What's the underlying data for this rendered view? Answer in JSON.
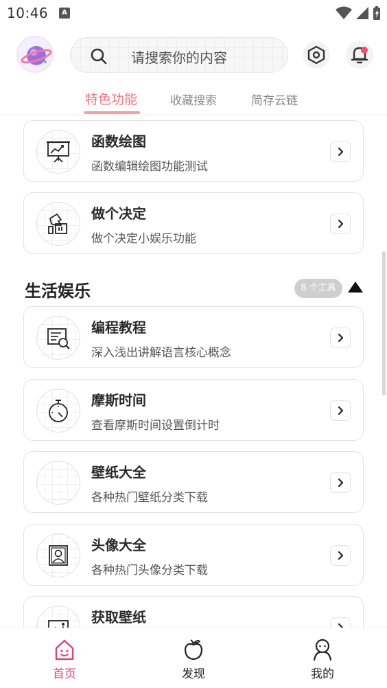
{
  "status_bar": {
    "time": "10:46",
    "notification_icon": "A"
  },
  "header": {
    "logo_icon": "planet-logo-icon",
    "search_placeholder": "请搜索你的内容",
    "settings_icon": "hexagon-settings-icon",
    "bell_icon": "bell-icon"
  },
  "tabs": [
    {
      "label": "特色功能",
      "active": true
    },
    {
      "label": "收藏搜索",
      "active": false
    },
    {
      "label": "简存云链",
      "active": false
    }
  ],
  "cards_top": [
    {
      "title": "函数绘图",
      "desc": "函数编辑绘图功能测试",
      "icon": "chart-board-icon"
    },
    {
      "title": "做个决定",
      "desc": "做个决定小娱乐功能",
      "icon": "hand-ballot-icon"
    }
  ],
  "section": {
    "title": "生活娱乐",
    "badge": "8 个工具",
    "toggle": "▲"
  },
  "cards_section": [
    {
      "title": "编程教程",
      "desc": "深入浅出讲解语言核心概念",
      "icon": "code-tutorial-icon"
    },
    {
      "title": "摩斯时间",
      "desc": "查看摩斯时间设置倒计时",
      "icon": "stopwatch-icon"
    },
    {
      "title": "壁纸大全",
      "desc": "各种热门壁纸分类下载",
      "icon": "wallpaper-icon"
    },
    {
      "title": "头像大全",
      "desc": "各种热门头像分类下载",
      "icon": "avatar-portrait-icon"
    },
    {
      "title": "获取壁纸",
      "desc": "",
      "icon": "image-icon"
    }
  ],
  "bottom_nav": [
    {
      "label": "首页",
      "active": true,
      "icon": "home-icon"
    },
    {
      "label": "发现",
      "active": false,
      "icon": "apple-icon"
    },
    {
      "label": "我的",
      "active": false,
      "icon": "person-icon"
    }
  ],
  "colors": {
    "accent": "#f0707a",
    "nav_active": "#e0407a",
    "badge": "#cfcfcf"
  }
}
